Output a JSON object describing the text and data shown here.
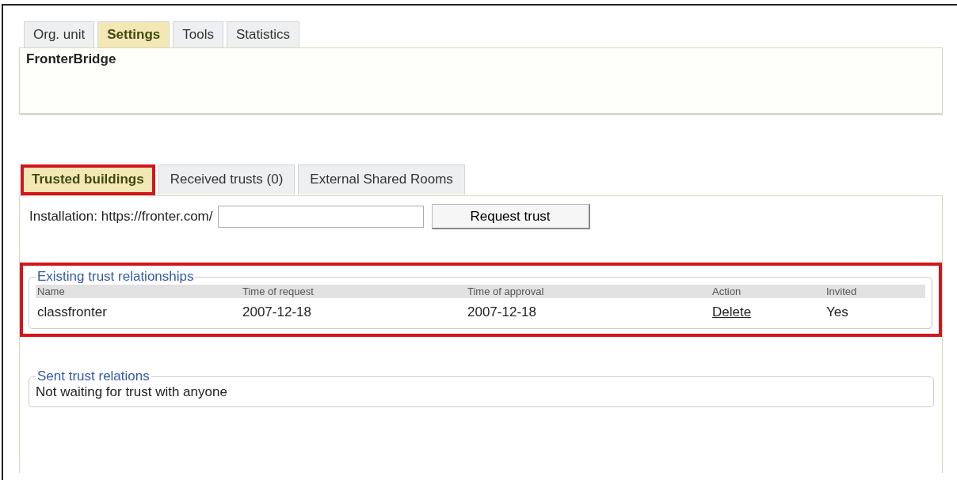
{
  "top_tabs": [
    {
      "label": "Org. unit",
      "selected": false
    },
    {
      "label": "Settings",
      "selected": true
    },
    {
      "label": "Tools",
      "selected": false
    },
    {
      "label": "Statistics",
      "selected": false
    }
  ],
  "unit_name": "FronterBridge",
  "sub_tabs": [
    {
      "label": "Trusted buildings",
      "selected": true,
      "highlighted": true
    },
    {
      "label": "Received trusts (0)",
      "selected": false,
      "highlighted": false
    },
    {
      "label": "External Shared Rooms",
      "selected": false,
      "highlighted": false
    }
  ],
  "installation": {
    "label": "Installation: https://fronter.com/",
    "button": "Request trust"
  },
  "existing": {
    "title": "Existing trust relationships",
    "highlighted": true,
    "columns": [
      "Name",
      "Time of request",
      "Time of approval",
      "Action",
      "Invited"
    ],
    "rows": [
      [
        "classfronter",
        "2007-12-18",
        "2007-12-18",
        "Delete",
        "Yes"
      ]
    ]
  },
  "sent": {
    "title": "Sent trust relations",
    "text": "Not waiting for trust with anyone"
  }
}
